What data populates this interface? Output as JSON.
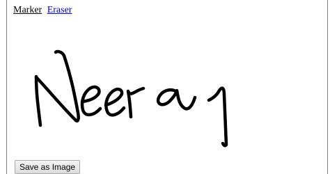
{
  "toolbar": {
    "marker_label": "Marker",
    "eraser_label": "Eraser"
  },
  "drawing": {
    "handwritten_text": "Neeraj",
    "stroke_color": "#000000"
  },
  "actions": {
    "save_label": "Save as Image"
  }
}
